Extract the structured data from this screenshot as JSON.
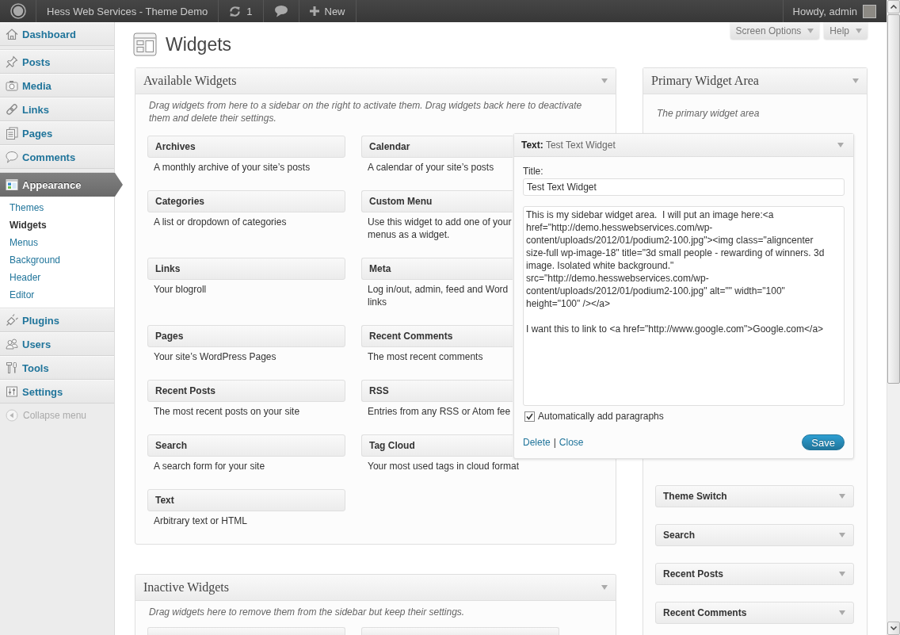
{
  "admin_bar": {
    "site_name": "Hess Web Services - Theme Demo",
    "updates_count": "1",
    "new_label": "New",
    "greeting": "Howdy, admin"
  },
  "sidebar": {
    "items": [
      {
        "label": "Dashboard",
        "kind": "dashboard",
        "selected": false
      },
      {
        "kind": "separator"
      },
      {
        "label": "Posts",
        "kind": "posts",
        "selected": false
      },
      {
        "label": "Media",
        "kind": "media",
        "selected": false
      },
      {
        "label": "Links",
        "kind": "links",
        "selected": false
      },
      {
        "label": "Pages",
        "kind": "pages",
        "selected": false
      },
      {
        "label": "Comments",
        "kind": "comments",
        "selected": false
      },
      {
        "kind": "separator"
      },
      {
        "label": "Appearance",
        "kind": "appearance",
        "selected": true,
        "children": [
          {
            "label": "Themes",
            "selected": false
          },
          {
            "label": "Widgets",
            "selected": true
          },
          {
            "label": "Menus",
            "selected": false
          },
          {
            "label": "Background",
            "selected": false
          },
          {
            "label": "Header",
            "selected": false
          },
          {
            "label": "Editor",
            "selected": false
          }
        ]
      },
      {
        "label": "Plugins",
        "kind": "plugins",
        "selected": false
      },
      {
        "label": "Users",
        "kind": "users",
        "selected": false
      },
      {
        "label": "Tools",
        "kind": "tools",
        "selected": false
      },
      {
        "label": "Settings",
        "kind": "settings",
        "selected": false
      }
    ],
    "collapse_label": "Collapse menu"
  },
  "screen_meta_buttons": [
    "Screen Options",
    "Help"
  ],
  "page_title": "Widgets",
  "available_widgets": {
    "title": "Available Widgets",
    "description": "Drag widgets from here to a sidebar on the right to activate them. Drag widgets back here to deactivate them and delete their settings.",
    "widgets": [
      {
        "title": "Archives",
        "description": "A monthly archive of your site’s posts"
      },
      {
        "title": "Calendar",
        "description": "A calendar of your site’s posts"
      },
      {
        "title": "Categories",
        "description": "A list or dropdown of categories"
      },
      {
        "title": "Custom Menu",
        "description": "Use this widget to add one of your\nmenus as a widget."
      },
      {
        "title": "Links",
        "description": "Your blogroll"
      },
      {
        "title": "Meta",
        "description": "Log in/out, admin, feed and Word\nlinks"
      },
      {
        "title": "Pages",
        "description": "Your site’s WordPress Pages"
      },
      {
        "title": "Recent Comments",
        "description": "The most recent comments"
      },
      {
        "title": "Recent Posts",
        "description": "The most recent posts on your site"
      },
      {
        "title": "RSS",
        "description": "Entries from any RSS or Atom fee"
      },
      {
        "title": "Search",
        "description": "A search form for your site"
      },
      {
        "title": "Tag Cloud",
        "description": "Your most used tags in cloud format"
      },
      {
        "title": "Text",
        "description": "Arbitrary text or HTML"
      }
    ]
  },
  "inactive_widgets": {
    "title": "Inactive Widgets",
    "description": "Drag widgets here to remove them from the sidebar but keep their settings.",
    "widgets": [
      {
        "kind": "cut_off"
      },
      {
        "kind": "cut_off"
      }
    ]
  },
  "primary_widget_area": {
    "title": "Primary Widget Area",
    "description": "The primary widget area",
    "open_widget": {
      "heading": "**Text:** Test Text Widget",
      "title_label": "Title:",
      "title_value": "Test Text Widget",
      "content": "This is my sidebar widget area.  I will put an image here:<a href=\"http://demo.hesswebservices.com/wp-content/uploads/2012/01/podium2-100.jpg\"><img class=\"aligncenter size-full wp-image-18\" title=\"3d small people - rewarding of winners. 3d image. Isolated white background.\" src=\"http://demo.hesswebservices.com/wp-content/uploads/2012/01/podium2-100.jpg\" alt=\"\" width=\"100\" height=\"100\" /></a>\n\nI want this to link to <a href=\"http://www.google.com\">Google.com</a>",
      "auto_paragraphs": {
        "label": "Automatically add paragraphs",
        "checked": true
      },
      "links": [
        "Delete",
        "Close"
      ],
      "link_separator": "|",
      "save_label": "Save"
    },
    "widgets": [
      {
        "title": "Theme Switch"
      },
      {
        "title": "Search"
      },
      {
        "title": "Recent Posts"
      },
      {
        "title": "Recent Comments"
      }
    ]
  }
}
